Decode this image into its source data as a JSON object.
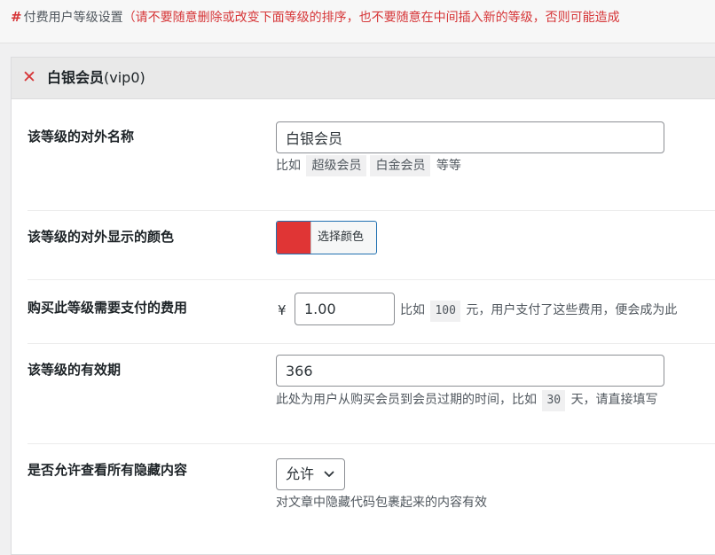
{
  "notice": {
    "hash": "#",
    "label": "付费用户等级设置",
    "warning": "（请不要随意删除或改变下面等级的排序，也不要随意在中间插入新的等级，否则可能造成"
  },
  "panel": {
    "title": "白银会员",
    "code": "(vip0)"
  },
  "fields": {
    "name": {
      "label": "该等级的对外名称",
      "value": "白银会员",
      "help_prefix": "比如",
      "examples": [
        "超级会员",
        "白金会员"
      ],
      "help_suffix": "等等"
    },
    "color": {
      "label": "该等级的对外显示的颜色",
      "swatch": "#e03535",
      "button_label": "选择颜色"
    },
    "price": {
      "label": "购买此等级需要支付的费用",
      "currency": "¥",
      "value": "1.00",
      "help_prefix": "比如",
      "example": "100",
      "help_suffix": "元，用户支付了这些费用，便会成为此"
    },
    "validity": {
      "label": "该等级的有效期",
      "value": "366",
      "help_prefix": "此处为用户从购买会员到会员过期的时间，比如",
      "example": "30",
      "help_suffix": "天，请直接填写"
    },
    "hidden": {
      "label": "是否允许查看所有隐藏内容",
      "selected": "允许",
      "help": "对文章中隐藏代码包裹起来的内容有效"
    }
  }
}
